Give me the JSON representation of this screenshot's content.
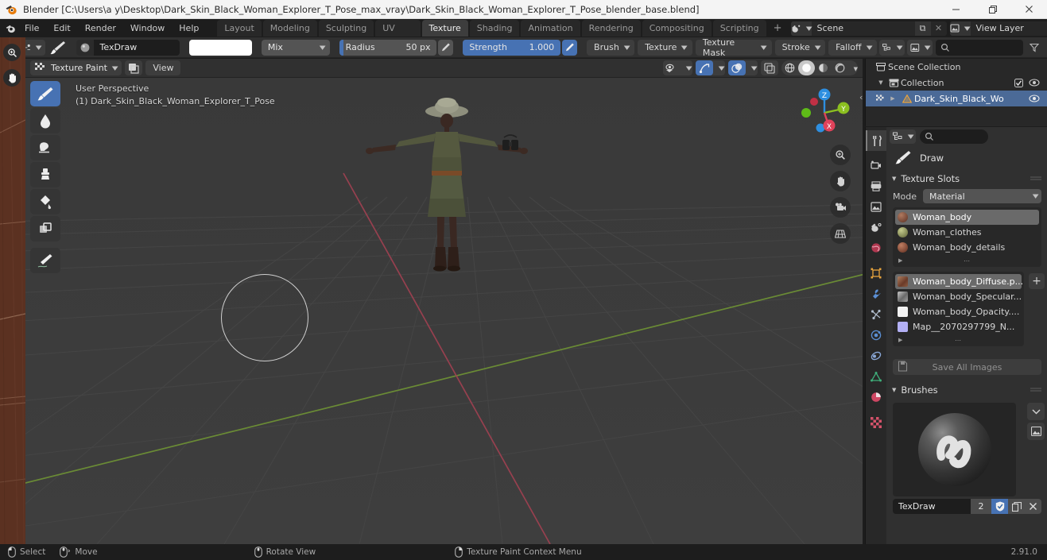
{
  "window": {
    "title": "Blender [C:\\Users\\a y\\Desktop\\Dark_Skin_Black_Woman_Explorer_T_Pose_max_vray\\Dark_Skin_Black_Woman_Explorer_T_Pose_blender_base.blend]",
    "minimize": "–",
    "maximize": "❐",
    "close": "✕"
  },
  "menus": [
    "File",
    "Edit",
    "Render",
    "Window",
    "Help"
  ],
  "workspace_tabs": [
    {
      "label": "Layout",
      "active": false
    },
    {
      "label": "Modeling",
      "active": false
    },
    {
      "label": "Sculpting",
      "active": false
    },
    {
      "label": "UV Editing",
      "active": false
    },
    {
      "label": "Texture Paint",
      "active": true
    },
    {
      "label": "Shading",
      "active": false
    },
    {
      "label": "Animation",
      "active": false
    },
    {
      "label": "Rendering",
      "active": false
    },
    {
      "label": "Compositing",
      "active": false
    },
    {
      "label": "Scripting",
      "active": false
    }
  ],
  "workspace_add": "+",
  "scene": {
    "name": "Scene",
    "new_btn": "⧉",
    "unlink_btn": "✕"
  },
  "view_layer": {
    "name": "View Layer",
    "new_btn": "⧉",
    "unlink_btn": "✕"
  },
  "tool_settings": {
    "brush_name": "TexDraw",
    "color_hex": "#ffffff",
    "blend_mode": "Mix",
    "radius_label": "Radius",
    "radius_value": "50 px",
    "radius_fill_pct": 4,
    "strength_label": "Strength",
    "strength_value": "1.000",
    "strength_fill_pct": 100,
    "popovers": [
      "Brush",
      "Texture",
      "Texture Mask",
      "Stroke",
      "Falloff"
    ],
    "search_placeholder": ""
  },
  "viewport_header": {
    "mode": "Texture Paint",
    "view_menu": "View",
    "mask_icon": "mask-icon"
  },
  "viewport": {
    "perspective_line1": "User Perspective",
    "perspective_line2": "(1) Dark_Skin_Black_Woman_Explorer_T_Pose",
    "gizmo_axes": [
      {
        "label": "Z",
        "color": "#2e8fe0"
      },
      {
        "label": "Y",
        "color": "#8cc020"
      },
      {
        "label": "X",
        "color": "#e0425a"
      }
    ],
    "tools": [
      {
        "name": "draw-tool",
        "active": true
      },
      {
        "name": "soften-tool",
        "active": false
      },
      {
        "name": "smear-tool",
        "active": false
      },
      {
        "name": "clone-tool",
        "active": false
      },
      {
        "name": "fill-tool",
        "active": false
      },
      {
        "name": "mask-tool",
        "active": false
      },
      {
        "name": "annotate-tool",
        "active": false
      }
    ],
    "nav_buttons": [
      "zoom-icon",
      "pan-icon",
      "camera-icon",
      "perspective-icon"
    ],
    "collapse_arrow": "‹"
  },
  "outliner": {
    "filter_icon": "filter-icon",
    "display_mode_icon": "outliner-display-icon",
    "image_mode_icon": "image-icon",
    "search_placeholder": "",
    "rows": [
      {
        "label": "Scene Collection",
        "indent": 0,
        "icon": "scene-collection-icon",
        "has_disclosure": false,
        "checkbox": false,
        "eye": false,
        "selected": false
      },
      {
        "label": "Collection",
        "indent": 1,
        "icon": "collection-icon",
        "has_disclosure": true,
        "checkbox": true,
        "eye": true,
        "selected": false
      },
      {
        "label": "Dark_Skin_Black_Wo",
        "indent": 2,
        "icon": "mesh-object-icon",
        "has_disclosure": true,
        "checkbox": false,
        "eye": true,
        "selected": true
      }
    ]
  },
  "properties": {
    "tabs": [
      {
        "name": "tool",
        "active": true,
        "color": "#d8d8d8"
      },
      {
        "name": "render",
        "active": false,
        "color": "#d0d0d0"
      },
      {
        "name": "output",
        "active": false,
        "color": "#d0d0d0"
      },
      {
        "name": "view-layer",
        "active": false,
        "color": "#d0d0d0"
      },
      {
        "name": "scene",
        "active": false,
        "color": "#d0d0d0"
      },
      {
        "name": "world",
        "active": false,
        "color": "#e06a80"
      },
      {
        "name": "object",
        "active": false,
        "color": "#e8a33d"
      },
      {
        "name": "modifiers",
        "active": false,
        "color": "#5b8fd4"
      },
      {
        "name": "particles",
        "active": false,
        "color": "#a8b4c4"
      },
      {
        "name": "physics",
        "active": false,
        "color": "#5b8fd4"
      },
      {
        "name": "constraints",
        "active": false,
        "color": "#8aa8d8"
      },
      {
        "name": "data",
        "active": false,
        "color": "#3fae7a"
      },
      {
        "name": "material",
        "active": false,
        "color": "#cf4763"
      },
      {
        "name": "texture",
        "active": false,
        "color": "#d4526a"
      }
    ],
    "editor_type_icon": "properties-editor-icon",
    "search_placeholder": "",
    "brush_row": {
      "label": "Draw",
      "icon": "brush-icon"
    },
    "texture_slots": {
      "title": "Texture Slots",
      "mode_label": "Mode",
      "mode_value": "Material",
      "materials": [
        {
          "label": "Woman_body",
          "swatch": "#7a4a3c",
          "selected": true
        },
        {
          "label": "Woman_clothes",
          "swatch": "#8a9056",
          "selected": false
        },
        {
          "label": "Woman_body_details",
          "swatch": "#8a4a3c",
          "selected": false
        }
      ],
      "textures": [
        {
          "label": "Woman_body_Diffuse.p...",
          "swatch": "#9a6a52",
          "selected": true
        },
        {
          "label": "Woman_body_Specular...",
          "swatch": "#9a9a9a",
          "selected": false
        },
        {
          "label": "Woman_body_Opacity....",
          "swatch": "#f0f0f0",
          "selected": false
        },
        {
          "label": "Map__2070297799_N...",
          "swatch": "#b3b0f5",
          "selected": false
        }
      ],
      "add_texture_btn": "+",
      "save_all_images": "Save All Images"
    },
    "brushes": {
      "title": "Brushes",
      "preview_icon": "brush-sphere-preview",
      "name": "TexDraw",
      "users_count": "2",
      "fake_user_icon": "shield-icon",
      "duplicate_icon": "copy-icon",
      "unlink_icon": "x-icon",
      "browse_icon": "chevron-down-icon",
      "image_icon": "image-icon"
    }
  },
  "statusbar": {
    "items": [
      {
        "mouse": "left-mouse-icon",
        "label": "Select"
      },
      {
        "mouse": "middle-mouse-drag-icon",
        "label": "Move"
      },
      {
        "mouse": "middle-mouse-icon",
        "label": "Rotate View"
      },
      {
        "mouse": "right-mouse-icon",
        "label": "Texture Paint Context Menu"
      }
    ],
    "version": "2.91.0"
  }
}
